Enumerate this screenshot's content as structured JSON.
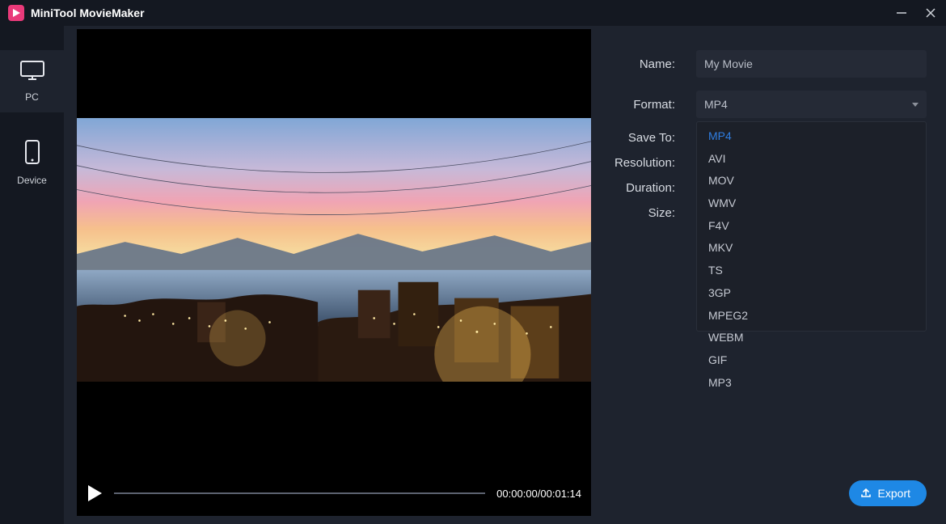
{
  "app": {
    "title": "MiniTool MovieMaker"
  },
  "sidebar": {
    "items": [
      {
        "key": "pc",
        "label": "PC",
        "icon": "monitor-icon",
        "active": true
      },
      {
        "key": "device",
        "label": "Device",
        "icon": "smartphone-icon",
        "active": false
      }
    ]
  },
  "player": {
    "current_time": "00:00:00",
    "total_time": "00:01:14",
    "timecode": "00:00:00/00:01:14"
  },
  "form": {
    "name_label": "Name:",
    "name_value": "My Movie",
    "format_label": "Format:",
    "format_selected": "MP4",
    "saveto_label": "Save To:",
    "resolution_label": "Resolution:",
    "duration_label": "Duration:",
    "size_label": "Size:",
    "format_options": [
      "MP4",
      "AVI",
      "MOV",
      "WMV",
      "F4V",
      "MKV",
      "TS",
      "3GP",
      "MPEG2",
      "WEBM",
      "GIF",
      "MP3"
    ]
  },
  "export": {
    "label": "Export"
  },
  "colors": {
    "accent": "#1e88e5",
    "brand": "#e93a7a",
    "bg_dark": "#141821",
    "bg_panel": "#1e232e",
    "input_bg": "#252a36"
  }
}
